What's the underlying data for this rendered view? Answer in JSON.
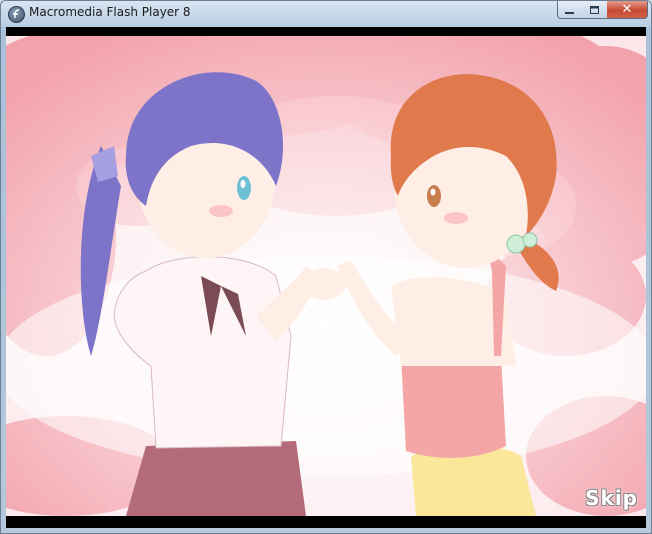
{
  "window": {
    "title": "Macromedia Flash Player 8",
    "controls": {
      "minimize_icon": "minimize-icon",
      "maximize_icon": "maximize-icon",
      "close_glyph": "✕"
    }
  },
  "stage": {
    "skip_label": "Skip",
    "scene_colors": {
      "background": "#fbe7ea",
      "tree_pink": "#f08a96",
      "left_hair": "#7d74c9",
      "right_hair": "#e07a4c",
      "shirt": "#fff4f6",
      "skirt": "#b36b7a",
      "top_pink": "#f4a6a6",
      "shorts": "#fbe79a",
      "skin": "#ffeee6"
    }
  }
}
